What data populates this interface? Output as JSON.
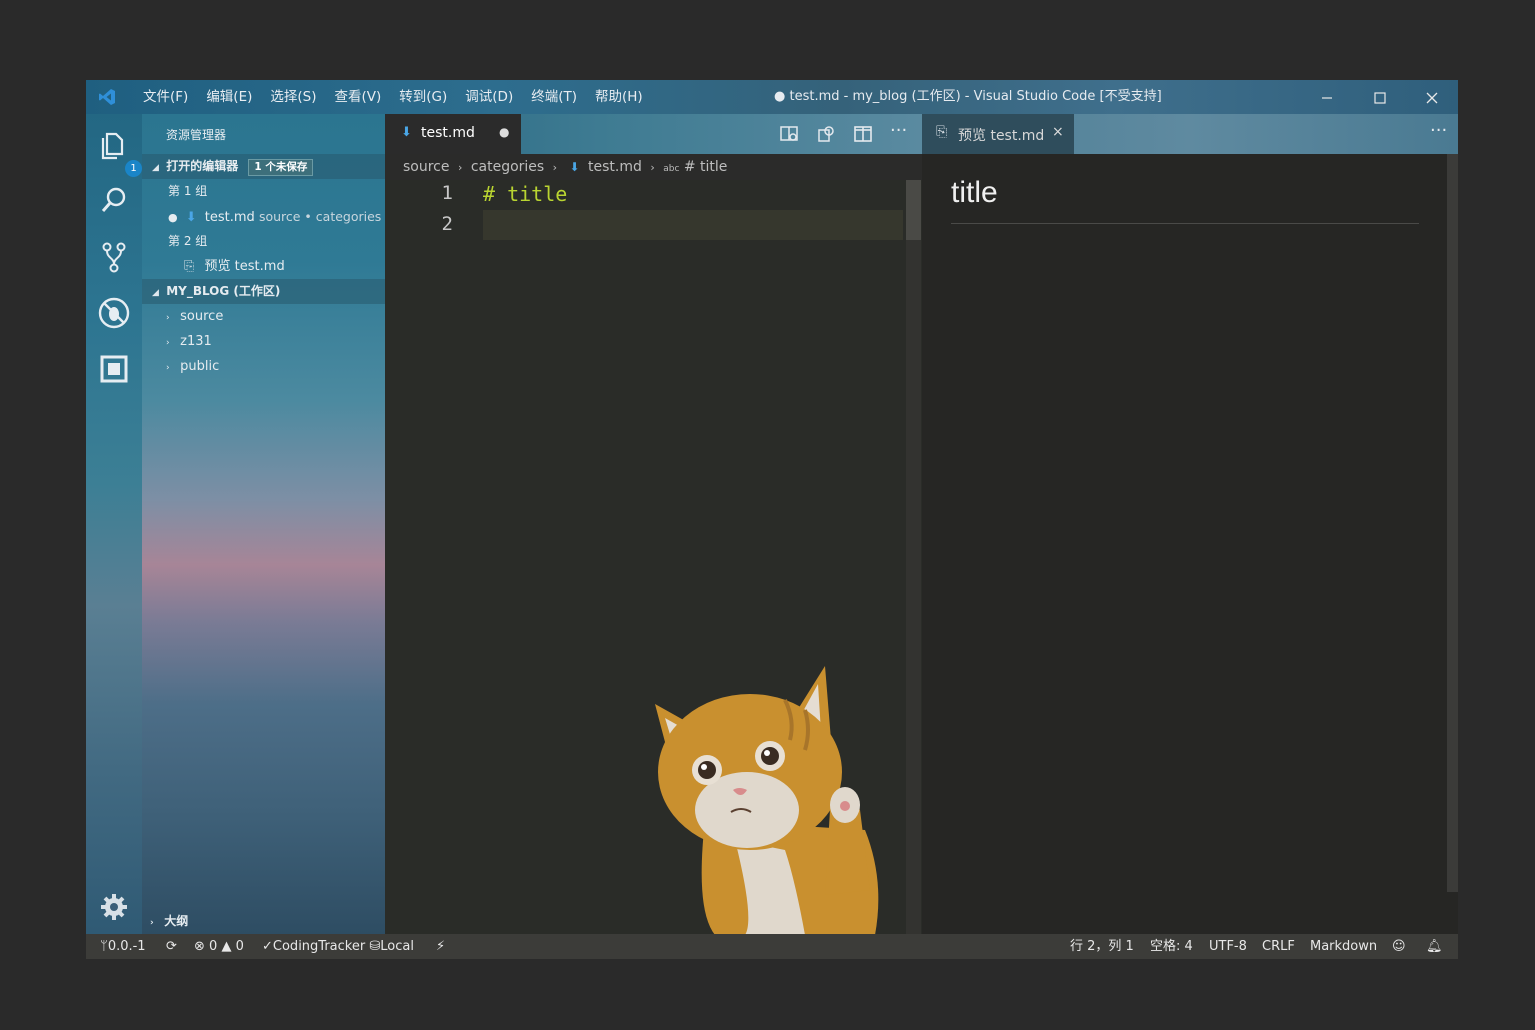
{
  "window_title": "● test.md - my_blog (工作区) - Visual Studio Code [不受支持]",
  "menu": [
    "文件(F)",
    "编辑(E)",
    "选择(S)",
    "查看(V)",
    "转到(G)",
    "调试(D)",
    "终端(T)",
    "帮助(H)"
  ],
  "activity_badge": "1",
  "sidebar": {
    "title": "资源管理器",
    "open_editors": {
      "label": "打开的编辑器",
      "unsaved_badge": "1 个未保存",
      "group1": "第 1 组",
      "file1_name": "test.md",
      "file1_path": "source • categories",
      "group2": "第 2 组",
      "file2_name": "预览 test.md"
    },
    "workspace": {
      "label": "MY_BLOG (工作区)",
      "folders": [
        "source",
        "z131",
        "public"
      ]
    },
    "outline": "大纲"
  },
  "editor": {
    "tab_label": "test.md",
    "breadcrumbs": [
      "source",
      "categories",
      "test.md",
      "# title"
    ],
    "breadcrumb_abc": "abc",
    "line_numbers": [
      "1",
      "2"
    ],
    "lines": [
      "# title",
      ""
    ]
  },
  "preview": {
    "tab_label": "预览 test.md",
    "heading": "title"
  },
  "status": {
    "branch": "0.0.-1",
    "errors": "0",
    "warnings": "0",
    "tracker": "CodingTracker",
    "local": "Local",
    "position": "行 2，列 1",
    "spaces": "空格: 4",
    "encoding": "UTF-8",
    "eol": "CRLF",
    "language": "Markdown"
  },
  "colors": {
    "code_accent": "#b9d431",
    "badge_blue": "#1a85c8"
  }
}
